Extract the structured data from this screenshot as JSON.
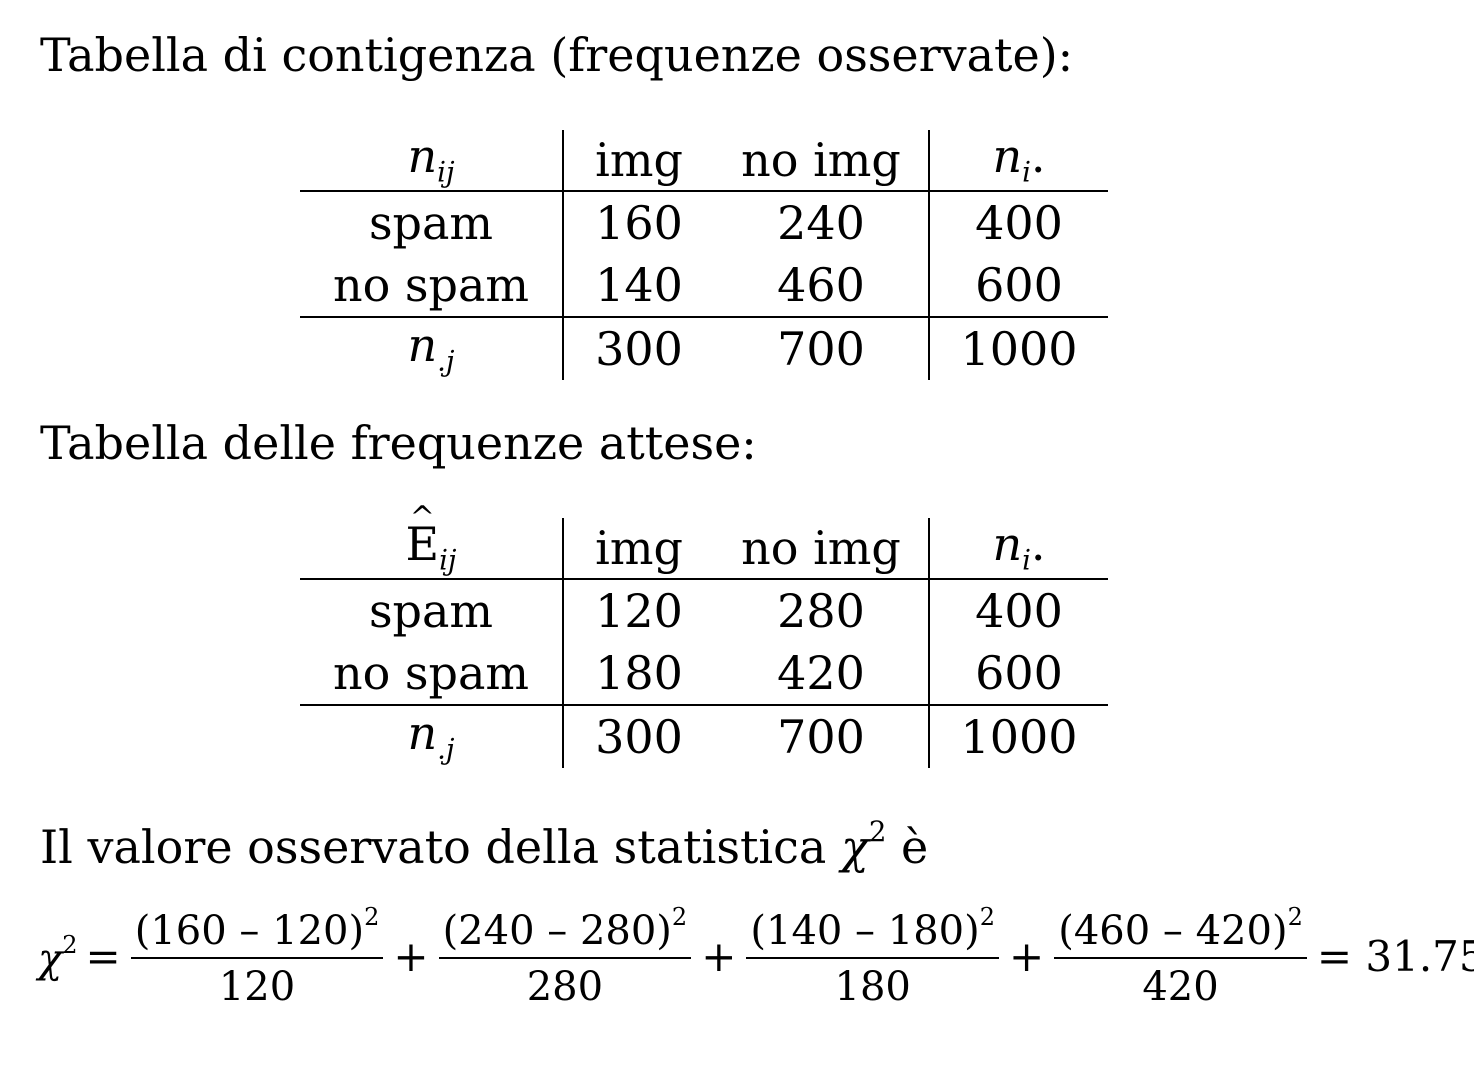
{
  "observed": {
    "heading": "Tabella di contigenza (frequenze osservate):",
    "corner": {
      "base": "n",
      "sub": "ij"
    },
    "columns": [
      "img",
      "no img"
    ],
    "row_total_header": {
      "base": "n",
      "sub": "i",
      "suffix": "."
    },
    "rows": [
      {
        "label": "spam",
        "values": [
          "160",
          "240"
        ],
        "total": "400"
      },
      {
        "label": "no spam",
        "values": [
          "140",
          "460"
        ],
        "total": "600"
      }
    ],
    "col_total_label": {
      "base": "n",
      "sub": ".j"
    },
    "col_totals": [
      "300",
      "700"
    ],
    "grand_total": "1000"
  },
  "expected": {
    "heading": "Tabella delle frequenze attese:",
    "corner": {
      "base": "E",
      "sub": "ij"
    },
    "columns": [
      "img",
      "no img"
    ],
    "row_total_header": {
      "base": "n",
      "sub": "i",
      "suffix": "."
    },
    "rows": [
      {
        "label": "spam",
        "values": [
          "120",
          "280"
        ],
        "total": "400"
      },
      {
        "label": "no spam",
        "values": [
          "180",
          "420"
        ],
        "total": "600"
      }
    ],
    "col_total_label": {
      "base": "n",
      "sub": ".j"
    },
    "col_totals": [
      "300",
      "700"
    ],
    "grand_total": "1000"
  },
  "statistic": {
    "sentence": "Il valore osservato della statistica",
    "symbol": "χ",
    "power": "2",
    "verb": "è"
  },
  "formula": {
    "lhs": "χ",
    "power": "2",
    "terms": [
      {
        "num": "(160 – 120)",
        "den": "120"
      },
      {
        "num": "(240 – 280)",
        "den": "280"
      },
      {
        "num": "(140 – 180)",
        "den": "180"
      },
      {
        "num": "(460 – 420)",
        "den": "420"
      }
    ],
    "result": "= 31.75"
  }
}
